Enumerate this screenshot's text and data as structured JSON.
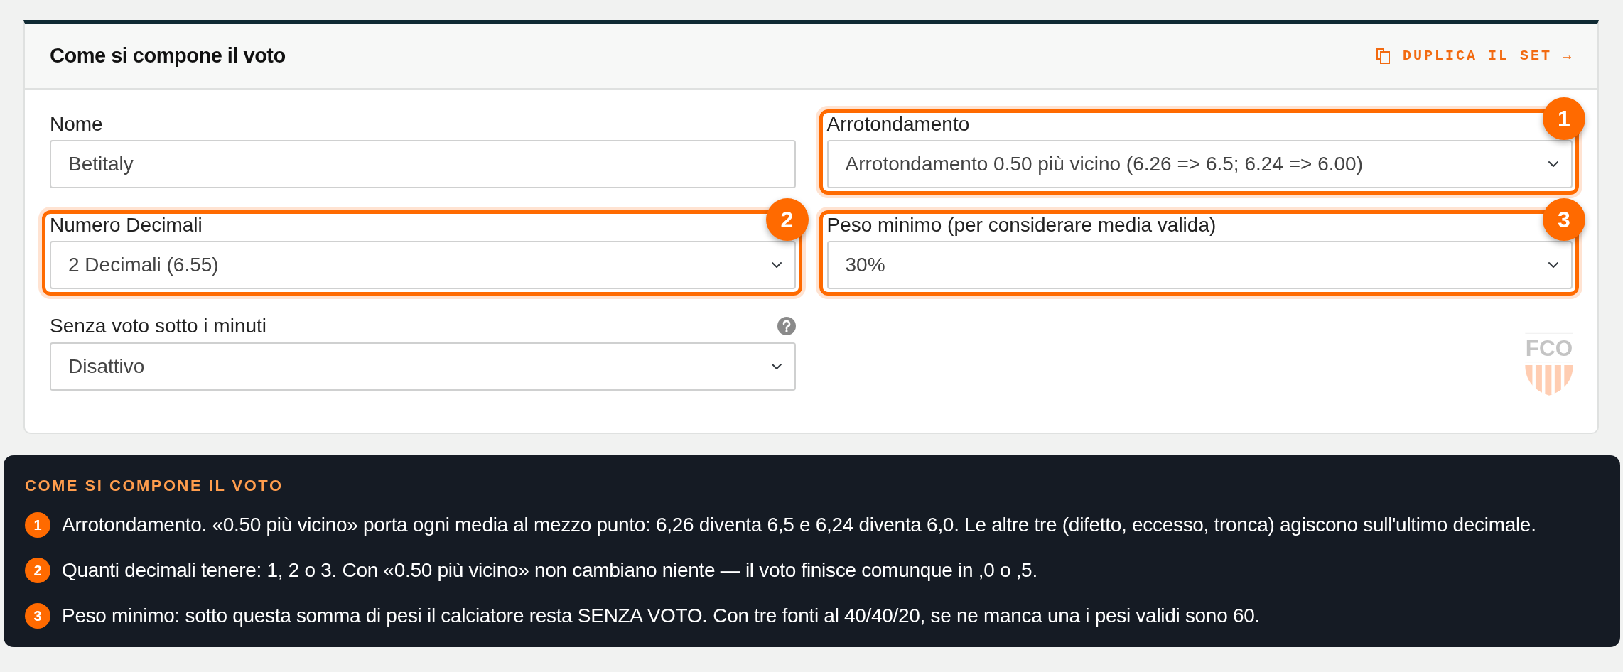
{
  "card": {
    "title": "Come si compone il voto",
    "action": {
      "label": "DUPLICA IL SET →"
    },
    "fields": [
      {
        "label": "Nome",
        "kind": "input",
        "value": "Betitaly",
        "help": false
      },
      {
        "label": "Arrotondamento",
        "kind": "select",
        "value": "Arrotondamento 0.50 più vicino (6.26 => 6.5; 6.24 => 6.00)",
        "help": false,
        "badge": "1"
      },
      {
        "label": "Numero Decimali",
        "kind": "select",
        "value": "2 Decimali (6.55)",
        "help": false,
        "badge": "2"
      },
      {
        "label": "Peso minimo (per considerare media valida)",
        "kind": "select",
        "value": "30%",
        "help": false,
        "badge": "3"
      },
      {
        "label": "Senza voto sotto i minuti",
        "kind": "select",
        "value": "Disattivo",
        "help": true
      }
    ],
    "logo": {
      "text": "FCO"
    }
  },
  "notes": {
    "title": "COME SI COMPONE IL VOTO",
    "items": [
      {
        "badge": "1",
        "text": "Arrotondamento. «0.50 più vicino» porta ogni media al mezzo punto: 6,26 diventa 6,5 e 6,24 diventa 6,0. Le altre tre (difetto, eccesso, tronca) agiscono sull'ultimo decimale."
      },
      {
        "badge": "2",
        "text": "Quanti decimali tenere: 1, 2 o 3. Con «0.50 più vicino» non cambiano niente — il voto finisce comunque in ,0 o ,5."
      },
      {
        "badge": "3",
        "text": "Peso minimo: sotto questa somma di pesi il calciatore resta SENZA VOTO. Con tre fonti al 40/40/20, se ne manca una i pesi validi sono 60."
      }
    ]
  }
}
